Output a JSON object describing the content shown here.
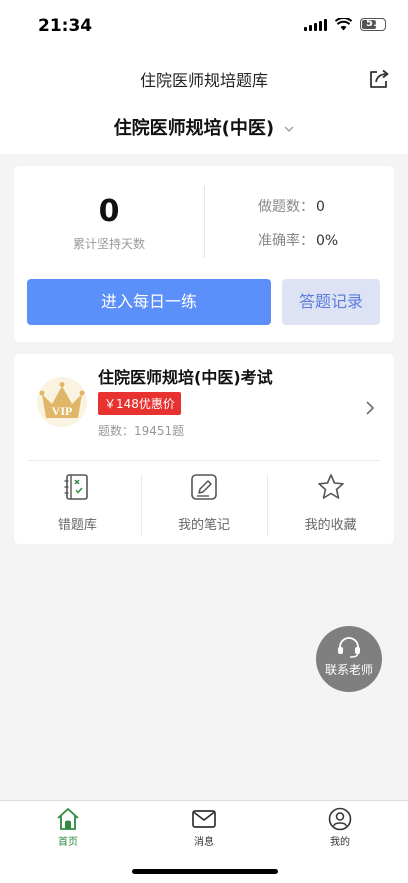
{
  "status_bar": {
    "time": "21:34",
    "battery": "51"
  },
  "nav": {
    "title": "住院医师规培题库"
  },
  "subject": {
    "title": "住院医师规培(中医)"
  },
  "stats": {
    "streak_value": "0",
    "streak_label": "累计坚持天数",
    "questions_done_label": "做题数：",
    "questions_done_value": "0",
    "accuracy_label": "准确率：",
    "accuracy_value": "0%"
  },
  "actions": {
    "practice_label": "进入每日一练",
    "record_label": "答题记录"
  },
  "exam": {
    "vip_text": "VIP",
    "title": "住院医师规培(中医)考试",
    "price_label": "￥148优惠价",
    "question_count": "题数：19451题"
  },
  "tools": [
    {
      "label": "错题库",
      "icon": "wrong-questions-icon"
    },
    {
      "label": "我的笔记",
      "icon": "notes-icon"
    },
    {
      "label": "我的收藏",
      "icon": "star-icon"
    }
  ],
  "contact": {
    "label": "联系老师"
  },
  "tabbar": [
    {
      "label": "首页",
      "icon": "home-icon",
      "active": true
    },
    {
      "label": "消息",
      "icon": "mail-icon",
      "active": false
    },
    {
      "label": "我的",
      "icon": "profile-icon",
      "active": false
    }
  ],
  "colors": {
    "primary": "#5b8ff9",
    "price": "#e8322f",
    "active_tab": "#2e8b3f"
  }
}
